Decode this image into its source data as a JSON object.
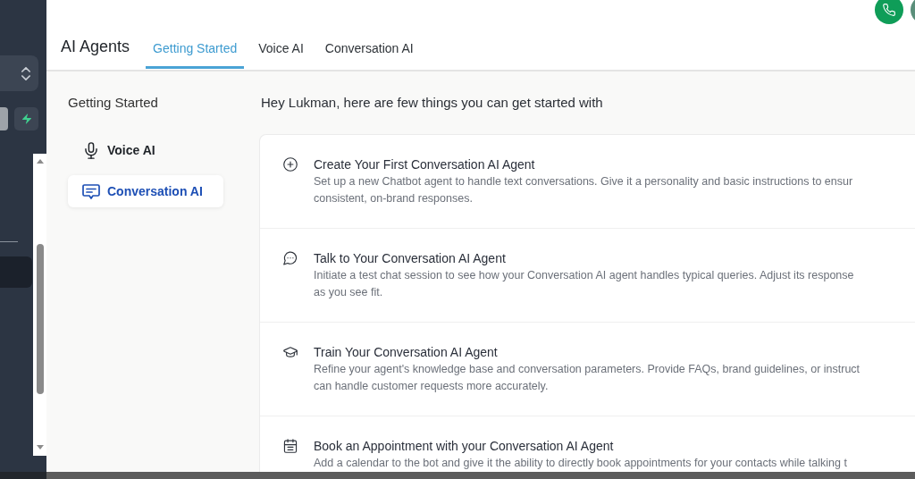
{
  "header": {
    "title": "AI Agents",
    "tabs": [
      {
        "label": "Getting Started",
        "selected": true
      },
      {
        "label": "Voice AI",
        "selected": false
      },
      {
        "label": "Conversation AI",
        "selected": false
      }
    ]
  },
  "side_menu": {
    "title": "Getting Started",
    "items": [
      {
        "label": "Voice AI",
        "selected": false
      },
      {
        "label": "Conversation AI",
        "selected": true
      }
    ]
  },
  "content": {
    "greeting": "Hey Lukman, here are few things you can get started with",
    "steps": [
      {
        "title": "Create Your First Conversation AI Agent",
        "description_lines": [
          "Set up a new Chatbot agent to handle text conversations. Give it a personality and basic instructions to ensur",
          "consistent, on-brand responses."
        ]
      },
      {
        "title": "Talk to Your Conversation AI Agent",
        "description_lines": [
          "Initiate a test chat session to see how your Conversation AI agent handles typical queries. Adjust its response",
          "as you see fit."
        ]
      },
      {
        "title": "Train Your Conversation AI Agent",
        "description_lines": [
          "Refine your agent's knowledge base and conversation parameters. Provide FAQs, brand guidelines, or instruct",
          "can handle customer requests more accurately."
        ]
      },
      {
        "title": "Book an Appointment with your Conversation AI Agent",
        "description_lines": [
          "Add a calendar to the bot and give it the ability to directly book appointments for your contacts while talking t"
        ]
      }
    ]
  }
}
